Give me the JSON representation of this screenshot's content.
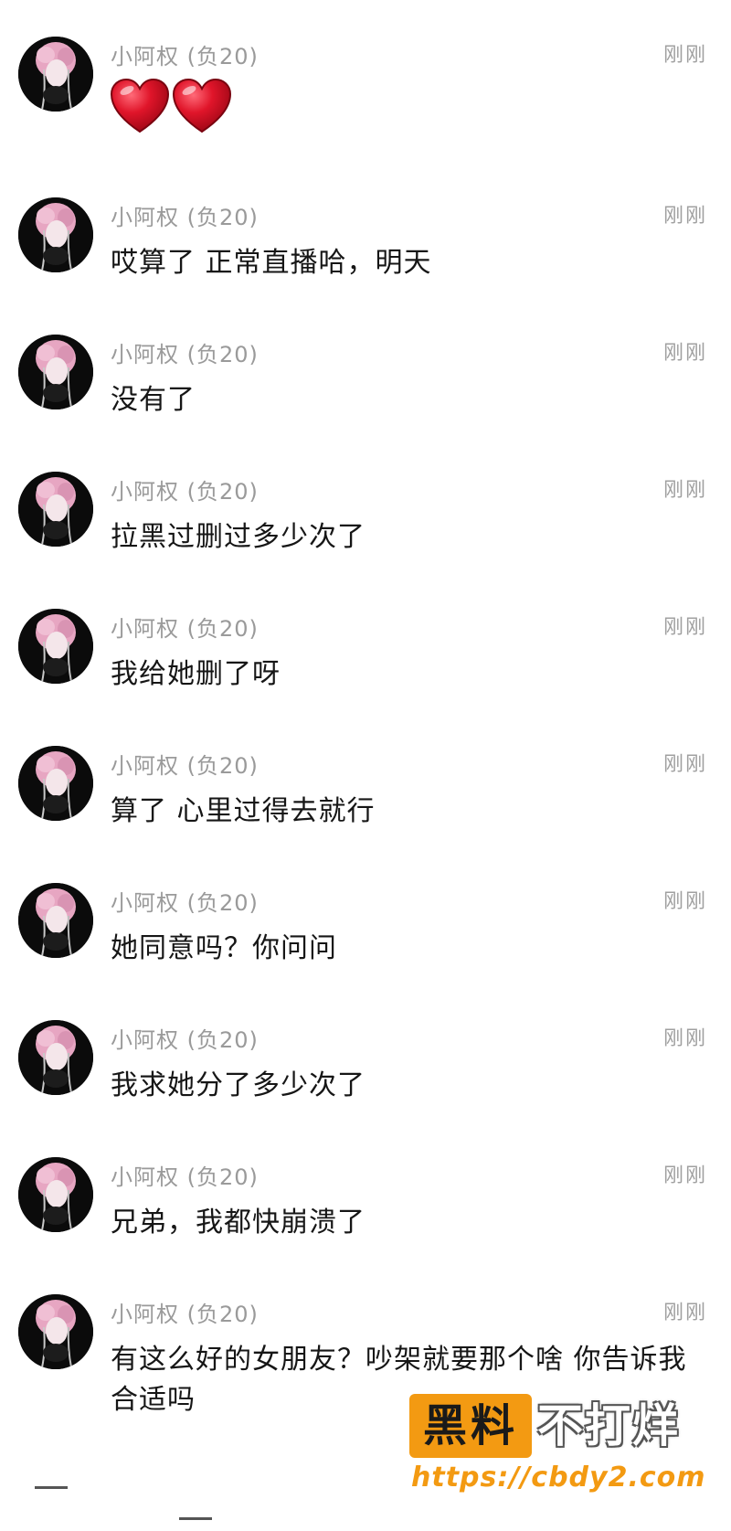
{
  "chat": {
    "messages": [
      {
        "sender": "小阿权 (负20)",
        "time": "刚刚",
        "type": "emoji",
        "text": ""
      },
      {
        "sender": "小阿权 (负20)",
        "time": "刚刚",
        "type": "text",
        "text": "哎算了 正常直播哈，明天"
      },
      {
        "sender": "小阿权 (负20)",
        "time": "刚刚",
        "type": "text",
        "text": "没有了"
      },
      {
        "sender": "小阿权 (负20)",
        "time": "刚刚",
        "type": "text",
        "text": "拉黑过删过多少次了"
      },
      {
        "sender": "小阿权 (负20)",
        "time": "刚刚",
        "type": "text",
        "text": "我给她删了呀"
      },
      {
        "sender": "小阿权 (负20)",
        "time": "刚刚",
        "type": "text",
        "text": "算了 心里过得去就行"
      },
      {
        "sender": "小阿权 (负20)",
        "time": "刚刚",
        "type": "text",
        "text": "她同意吗？你问问"
      },
      {
        "sender": "小阿权 (负20)",
        "time": "刚刚",
        "type": "text",
        "text": "我求她分了多少次了"
      },
      {
        "sender": "小阿权 (负20)",
        "time": "刚刚",
        "type": "text",
        "text": "兄弟，我都快崩溃了"
      },
      {
        "sender": "小阿权 (负20)",
        "time": "刚刚",
        "type": "text",
        "text": "有这么好的女朋友？吵架就要那个啥 你告诉我合适吗"
      }
    ],
    "emoji_icon": "red-heart-icon",
    "emoji_count": 2,
    "accent_heart": "#e0152a"
  },
  "watermark": {
    "badge": "黑料",
    "side": "不打烊",
    "url": "https://cbdy2.com",
    "color": "#f39a12"
  }
}
